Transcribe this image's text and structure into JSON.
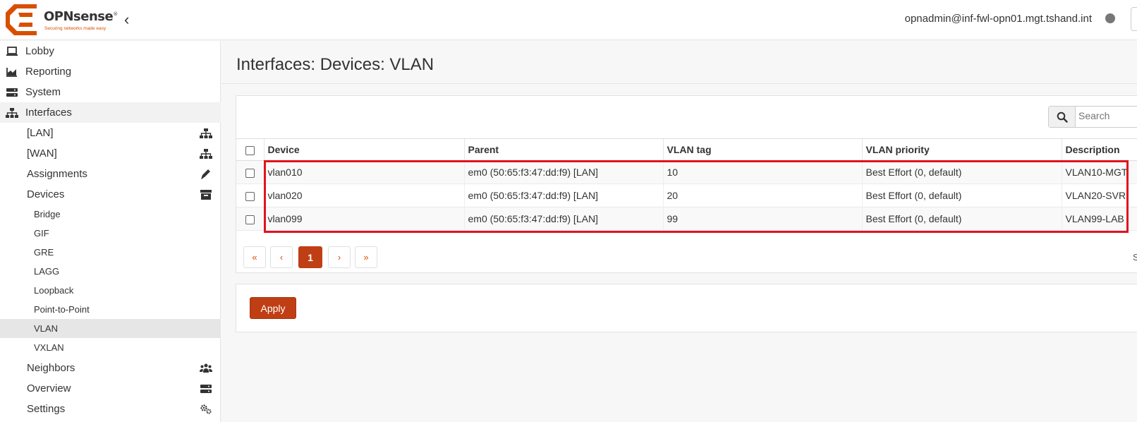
{
  "header": {
    "logo_text": "OPNsense",
    "logo_reg": "®",
    "logo_tagline": "Securing networks made easy",
    "collapse_icon": "chevron-left-icon",
    "collapse_glyph": "‹",
    "user": "opnadmin@inf-fwl-opn01.mgt.tshand.int",
    "brand_color": "#d94f00"
  },
  "sidebar": {
    "items": [
      {
        "label": "Lobby",
        "icon": "laptop-icon"
      },
      {
        "label": "Reporting",
        "icon": "area-chart-icon"
      },
      {
        "label": "System",
        "icon": "server-icon"
      },
      {
        "label": "Interfaces",
        "icon": "sitemap-icon"
      },
      {
        "label": "[LAN]",
        "icon": "sitemap-icon"
      },
      {
        "label": "[WAN]",
        "icon": "sitemap-icon"
      },
      {
        "label": "Assignments",
        "icon": "pencil-icon"
      },
      {
        "label": "Devices",
        "icon": "archive-icon"
      },
      {
        "label": "Bridge"
      },
      {
        "label": "GIF"
      },
      {
        "label": "GRE"
      },
      {
        "label": "LAGG"
      },
      {
        "label": "Loopback"
      },
      {
        "label": "Point-to-Point"
      },
      {
        "label": "VLAN"
      },
      {
        "label": "VXLAN"
      },
      {
        "label": "Neighbors",
        "icon": "users-icon"
      },
      {
        "label": "Overview",
        "icon": "server-icon"
      },
      {
        "label": "Settings",
        "icon": "cogs-icon"
      }
    ]
  },
  "main": {
    "title": "Interfaces: Devices: VLAN",
    "search_placeholder": "Search",
    "table": {
      "columns": [
        "Device",
        "Parent",
        "VLAN tag",
        "VLAN priority",
        "Description"
      ],
      "rows": [
        {
          "device": "vlan010",
          "parent": "em0 (50:65:f3:47:dd:f9) [LAN]",
          "tag": "10",
          "priority": "Best Effort (0, default)",
          "description": "VLAN10-MGT"
        },
        {
          "device": "vlan020",
          "parent": "em0 (50:65:f3:47:dd:f9) [LAN]",
          "tag": "20",
          "priority": "Best Effort (0, default)",
          "description": "VLAN20-SVR"
        },
        {
          "device": "vlan099",
          "parent": "em0 (50:65:f3:47:dd:f9) [LAN]",
          "tag": "99",
          "priority": "Best Effort (0, default)",
          "description": "VLAN99-LAB"
        }
      ]
    },
    "pager": {
      "first": "«",
      "prev": "‹",
      "current": "1",
      "next": "›",
      "last": "»",
      "right_text": "S"
    },
    "apply_label": "Apply",
    "accent_color": "#c03e14",
    "highlight_color": "#e0141d"
  }
}
